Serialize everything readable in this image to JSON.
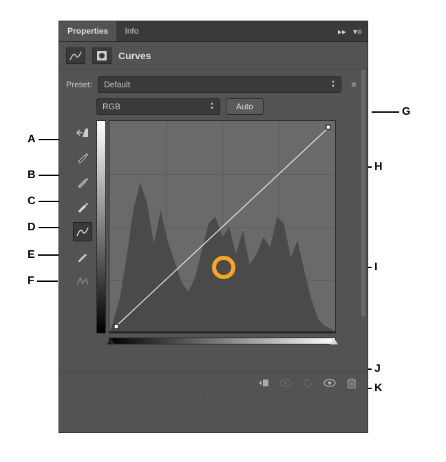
{
  "tabs": {
    "properties": "Properties",
    "info": "Info"
  },
  "panel_title": "Curves",
  "preset": {
    "label": "Preset:",
    "value": "Default"
  },
  "channel": {
    "value": "RGB"
  },
  "auto_label": "Auto",
  "callouts": {
    "A": "A",
    "B": "B",
    "C": "C",
    "D": "D",
    "E": "E",
    "F": "F",
    "G": "G",
    "H": "H",
    "I": "I",
    "J": "J",
    "K": "K"
  }
}
